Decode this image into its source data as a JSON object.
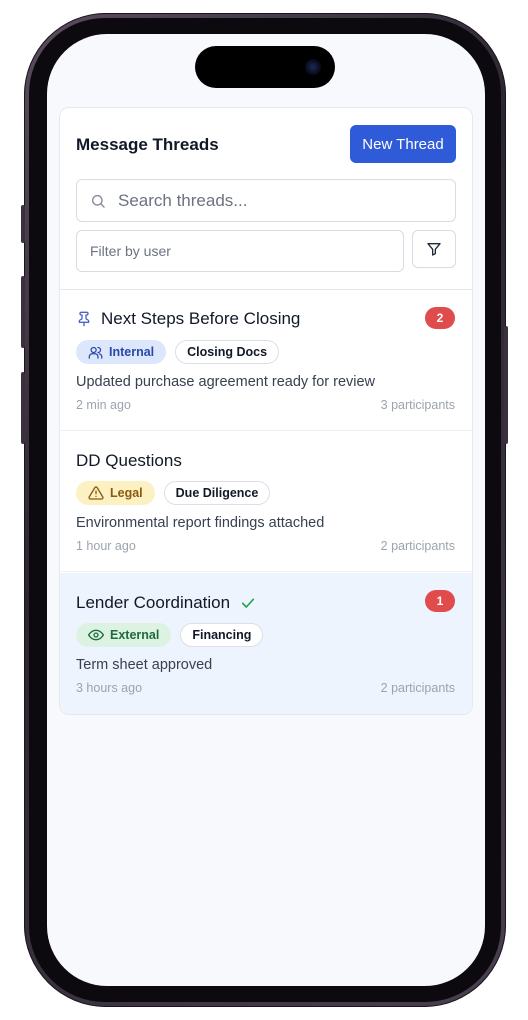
{
  "header": {
    "title": "Message Threads",
    "new_thread_label": "New Thread",
    "search_placeholder": "Search threads...",
    "filter_placeholder": "Filter by user"
  },
  "threads": [
    {
      "title": "Next Steps Before Closing",
      "pinned": true,
      "resolved": false,
      "unread": "2",
      "tags": [
        {
          "label": "Internal",
          "kind": "internal",
          "icon": "users-icon"
        },
        {
          "label": "Closing Docs",
          "kind": "plain",
          "icon": ""
        }
      ],
      "preview": "Updated purchase agreement ready for review",
      "time": "2 min ago",
      "participants": "3 participants"
    },
    {
      "title": "DD Questions",
      "pinned": false,
      "resolved": false,
      "unread": "",
      "tags": [
        {
          "label": "Legal",
          "kind": "legal",
          "icon": "warning-icon"
        },
        {
          "label": "Due Diligence",
          "kind": "plain",
          "icon": ""
        }
      ],
      "preview": "Environmental report findings attached",
      "time": "1 hour ago",
      "participants": "2 participants"
    },
    {
      "title": "Lender Coordination",
      "pinned": false,
      "resolved": true,
      "unread": "1",
      "tags": [
        {
          "label": "External",
          "kind": "external",
          "icon": "eye-icon"
        },
        {
          "label": "Financing",
          "kind": "plain",
          "icon": ""
        }
      ],
      "preview": "Term sheet approved",
      "time": "3 hours ago",
      "participants": "2 participants"
    }
  ],
  "colors": {
    "accent": "#2f5bd8",
    "badge": "#e04b4b",
    "selected_bg": "#eef4fd"
  }
}
